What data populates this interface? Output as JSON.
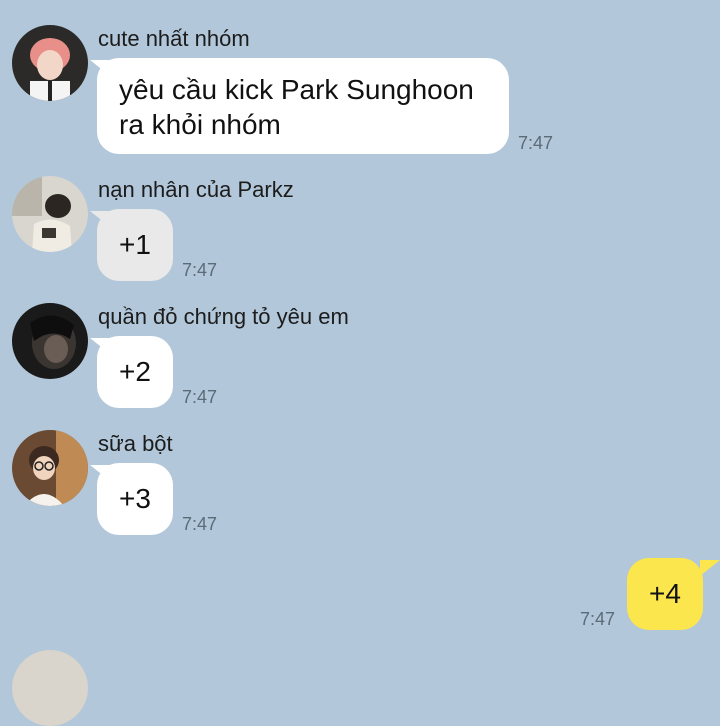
{
  "messages": [
    {
      "sender": "cute nhất nhóm",
      "text": "yêu cầu kick Park Sunghoon ra khỏi nhóm",
      "time": "7:47",
      "avatar": "user-photo-pink-hair"
    },
    {
      "sender": "nạn nhân của Parkz",
      "text": "+1",
      "time": "7:47",
      "avatar": "user-photo-crouching"
    },
    {
      "sender": "quần đỏ chứng tỏ yêu em",
      "text": "+2",
      "time": "7:47",
      "avatar": "user-photo-dark"
    },
    {
      "sender": "sữa bột",
      "text": "+3",
      "time": "7:47",
      "avatar": "user-photo-glasses"
    }
  ],
  "my_message": {
    "text": "+4",
    "time": "7:47"
  },
  "colors": {
    "background": "#b2c7d9",
    "incoming_bubble": "#ffffff",
    "outgoing_bubble": "#fbe64d"
  }
}
